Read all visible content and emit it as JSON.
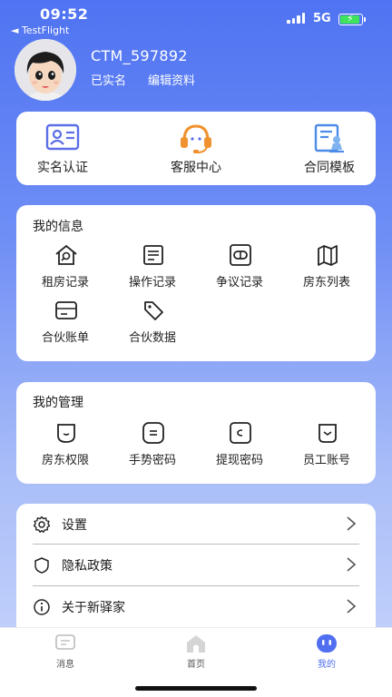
{
  "status_bar": {
    "time": "09:52",
    "back_app": "◄ TestFlight",
    "network": "5G"
  },
  "profile": {
    "username": "CTM_597892",
    "verified_status": "已实名",
    "edit_label": "编辑资料"
  },
  "quick_actions": [
    {
      "label": "实名认证",
      "icon": "id-card-icon"
    },
    {
      "label": "客服中心",
      "icon": "headset-icon"
    },
    {
      "label": "合同模板",
      "icon": "contract-icon"
    }
  ],
  "my_info": {
    "title": "我的信息",
    "items": [
      {
        "label": "租房记录",
        "icon": "house-search-icon"
      },
      {
        "label": "操作记录",
        "icon": "log-icon"
      },
      {
        "label": "争议记录",
        "icon": "dispute-icon"
      },
      {
        "label": "房东列表",
        "icon": "map-icon"
      },
      {
        "label": "合伙账单",
        "icon": "bill-icon"
      },
      {
        "label": "合伙数据",
        "icon": "tag-icon"
      }
    ]
  },
  "my_management": {
    "title": "我的管理",
    "items": [
      {
        "label": "房东权限",
        "icon": "landlord-permission-icon"
      },
      {
        "label": "手势密码",
        "icon": "gesture-password-icon"
      },
      {
        "label": "提现密码",
        "icon": "withdraw-password-icon"
      },
      {
        "label": "员工账号",
        "icon": "staff-account-icon"
      }
    ]
  },
  "settings": [
    {
      "label": "设置",
      "icon": "gear-icon"
    },
    {
      "label": "隐私政策",
      "icon": "shield-icon"
    },
    {
      "label": "关于新驿家",
      "icon": "info-icon"
    }
  ],
  "tab_bar": {
    "items": [
      {
        "label": "消息",
        "icon": "message-icon",
        "active": false
      },
      {
        "label": "首页",
        "icon": "home-icon",
        "active": false
      },
      {
        "label": "我的",
        "icon": "profile-icon",
        "active": true
      }
    ]
  },
  "colors": {
    "accent": "#4f6ff0",
    "quick_icon": "#5b6ee8",
    "headset_orange": "#f0922e",
    "battery_green": "#3ee35b"
  }
}
